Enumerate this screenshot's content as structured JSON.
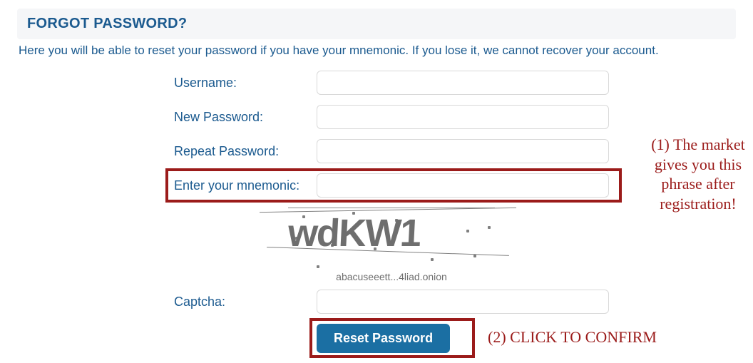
{
  "header": {
    "title": "FORGOT PASSWORD?"
  },
  "subtext": "Here you will be able to reset your password if you have your mnemonic. If you lose it, we cannot recover your account.",
  "form": {
    "username_label": "Username:",
    "new_password_label": "New Password:",
    "repeat_password_label": "Repeat Password:",
    "mnemonic_label": "Enter your mnemonic:",
    "captcha_label": "Captcha:",
    "reset_button": "Reset Password"
  },
  "captcha": {
    "text": "wdKW1",
    "subtext": "abacuseeett...4liad.onion"
  },
  "annotations": {
    "right": "(1) The market gives you this phrase after registration!",
    "bottom": "(2) CLICK TO CONFIRM"
  }
}
